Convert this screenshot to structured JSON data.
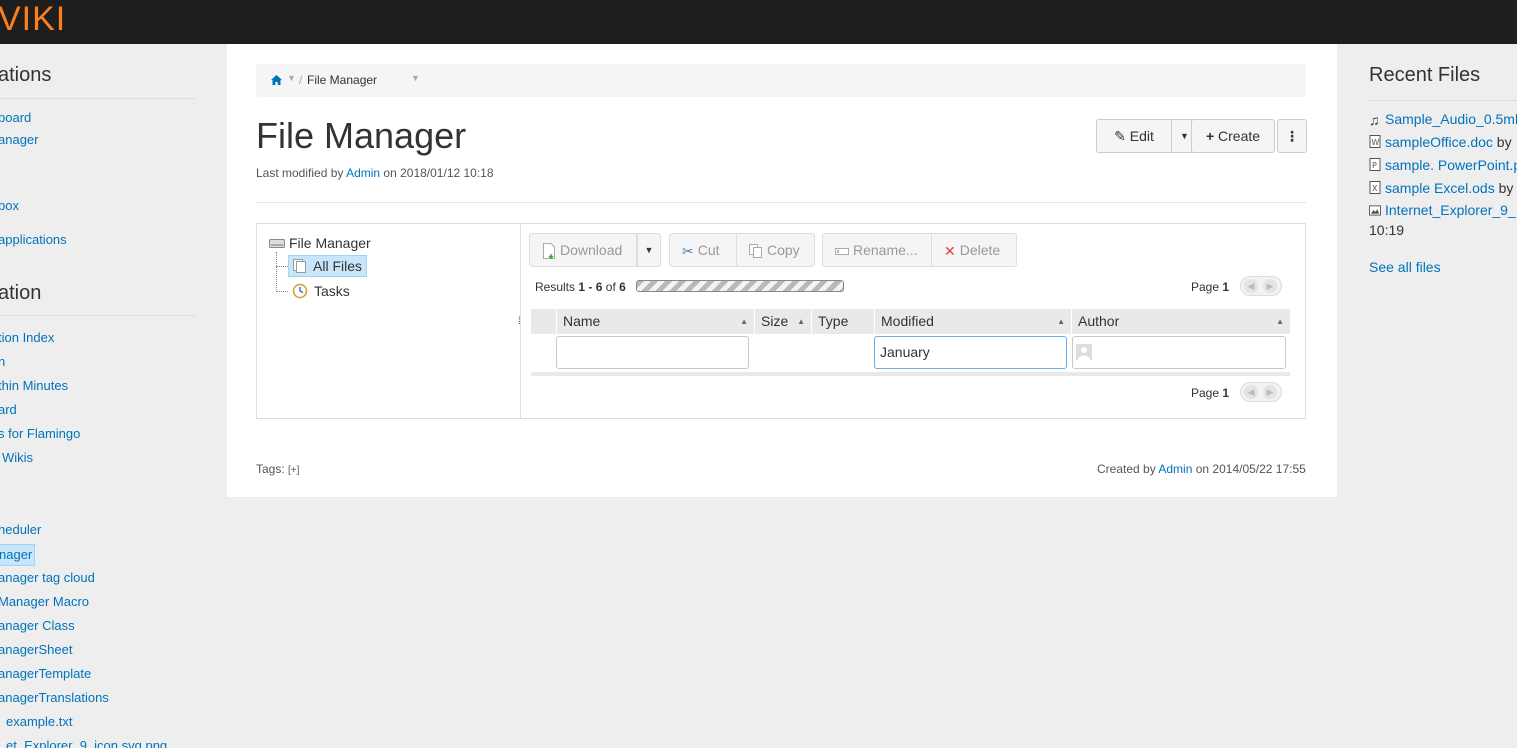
{
  "logo": "VIKI",
  "left_sidebar": {
    "section1_title": "ations",
    "section1_items": [
      "board",
      "anager",
      "box",
      "applications"
    ],
    "section2_title": "ation",
    "section2_items": [
      "tion Index",
      "n",
      "thin Minutes",
      "ard",
      "s for Flamingo",
      "Wikis"
    ],
    "section3_items": [
      "heduler",
      "nager",
      "anager tag cloud",
      "Manager Macro",
      "anager Class",
      "anagerSheet",
      "anagerTemplate",
      "anagerTranslations",
      "example.txt",
      "et_Explorer_9_icon.svg.png"
    ]
  },
  "breadcrumb": {
    "current": "File Manager",
    "sep": "/"
  },
  "page": {
    "title": "File Manager",
    "lastmod_prefix": "Last modified by",
    "lastmod_user": "Admin",
    "lastmod_suffix": "on 2018/01/12 10:18"
  },
  "actions": {
    "edit": "Edit",
    "create": "Create"
  },
  "tree": {
    "root": "File Manager",
    "all_files": "All Files",
    "tasks": "Tasks"
  },
  "toolbar": {
    "download": "Download",
    "cut": "Cut",
    "copy": "Copy",
    "rename": "Rename...",
    "delete": "Delete"
  },
  "results": {
    "prefix": "Results",
    "from": "1",
    "dash": "-",
    "to": "6",
    "of": "of",
    "total": "6"
  },
  "pager": {
    "label": "Page",
    "page": "1"
  },
  "grid": {
    "columns": [
      "Name",
      "Size",
      "Type",
      "Modified",
      "Author"
    ],
    "filter_modified": "January"
  },
  "footer": {
    "tags_label": "Tags:",
    "tags_add": "[+]",
    "created_prefix": "Created by",
    "created_user": "Admin",
    "created_suffix": "on 2014/05/22 17:55"
  },
  "right_sidebar": {
    "title": "Recent Files",
    "items": [
      {
        "name": "Sample_Audio_0.5ml",
        "by": ""
      },
      {
        "name": "sampleOffice.doc",
        "by": "by"
      },
      {
        "name": "sample. PowerPoint.p",
        "by": ""
      },
      {
        "name": "sample Excel.ods",
        "by": "by"
      },
      {
        "name": "Internet_Explorer_9_",
        "by": ""
      }
    ],
    "time": "10:19",
    "see_all": "See all files"
  }
}
